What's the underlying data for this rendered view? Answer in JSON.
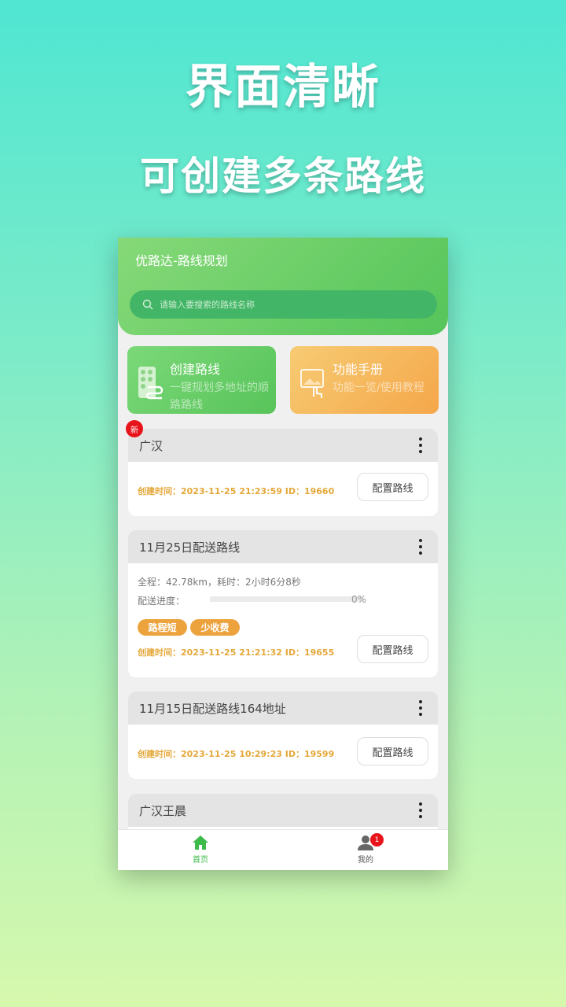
{
  "promo": {
    "line1": "界面清晰",
    "line2": "可创建多条路线"
  },
  "app": {
    "title": "优路达-路线规划",
    "search_placeholder": "请输入要搜索的路线名称"
  },
  "features": [
    {
      "title": "创建路线",
      "subtitle": "一键规划多地址的顺路路线",
      "icon": "building-route-icon"
    },
    {
      "title": "功能手册",
      "subtitle": "功能一览/使用教程",
      "icon": "image-touch-icon"
    }
  ],
  "new_badge": "新",
  "routes": [
    {
      "name": "广汉",
      "meta": "创建时间：2023-11-25 21:23:59  ID：19660",
      "button": "配置路线"
    },
    {
      "name": "11月25日配送路线",
      "summary": "全程：42.78km，耗时：2小时6分8秒",
      "progress_label": "配送进度：",
      "progress": 0,
      "progress_text": "0%",
      "tags": [
        "路程短",
        "少收费"
      ],
      "meta": "创建时间：2023-11-25 21:21:32  ID：19655",
      "button": "配置路线"
    },
    {
      "name": "11月15日配送路线164地址",
      "meta": "创建时间：2023-11-25 10:29:23  ID：19599",
      "button": "配置路线"
    },
    {
      "name": "广汉王晨"
    }
  ],
  "nav": {
    "home": "首页",
    "mine": "我的",
    "mine_badge": "1",
    "active_color": "#3dbb4a"
  }
}
